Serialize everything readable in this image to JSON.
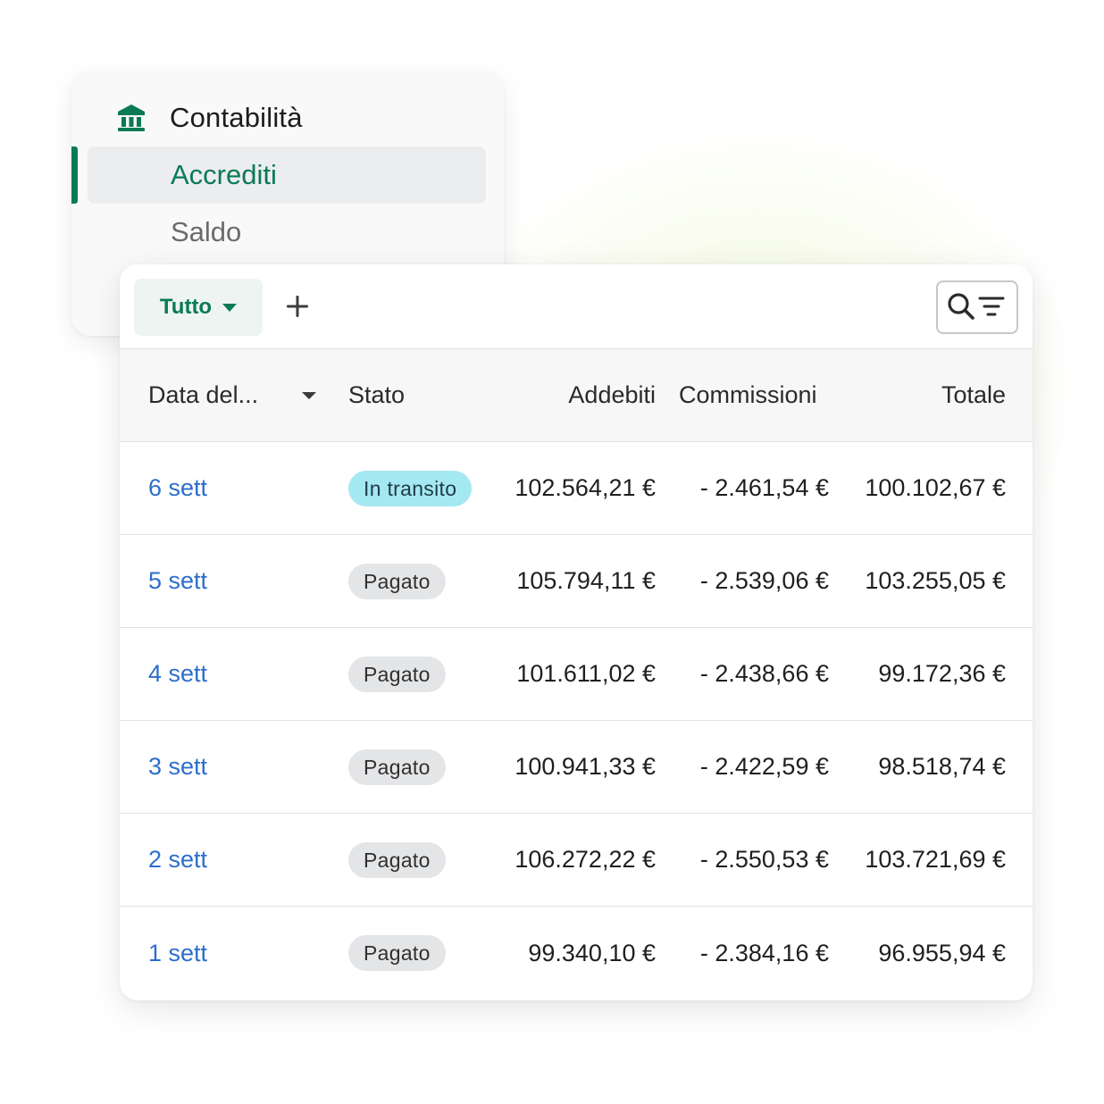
{
  "sidebar": {
    "title": "Contabilità",
    "title_icon": "bank-icon",
    "items": [
      {
        "label": "Accrediti",
        "active": true
      },
      {
        "label": "Saldo",
        "active": false
      }
    ],
    "accent_color": "#0a7a56"
  },
  "toolbar": {
    "filter_label": "Tutto",
    "add_icon": "plus-icon",
    "search_icon": "search-filter-icon"
  },
  "table": {
    "headers": {
      "date": "Data del...",
      "status": "Stato",
      "charges": "Addebiti",
      "fees": "Commissioni",
      "total": "Totale"
    },
    "rows": [
      {
        "date": "6 sett",
        "status": "In transito",
        "status_type": "transit",
        "charges": "102.564,21 €",
        "fees": "- 2.461,54 €",
        "total": "100.102,67 €"
      },
      {
        "date": "5 sett",
        "status": "Pagato",
        "status_type": "paid",
        "charges": "105.794,11 €",
        "fees": "- 2.539,06 €",
        "total": "103.255,05 €"
      },
      {
        "date": "4 sett",
        "status": "Pagato",
        "status_type": "paid",
        "charges": "101.611,02 €",
        "fees": "- 2.438,66 €",
        "total": "99.172,36 €"
      },
      {
        "date": "3 sett",
        "status": "Pagato",
        "status_type": "paid",
        "charges": "100.941,33 €",
        "fees": "- 2.422,59 €",
        "total": "98.518,74 €"
      },
      {
        "date": "2 sett",
        "status": "Pagato",
        "status_type": "paid",
        "charges": "106.272,22 €",
        "fees": "- 2.550,53 €",
        "total": "103.721,69 €"
      },
      {
        "date": "1 sett",
        "status": "Pagato",
        "status_type": "paid",
        "charges": "99.340,10 €",
        "fees": "- 2.384,16 €",
        "total": "96.955,94 €"
      }
    ]
  }
}
